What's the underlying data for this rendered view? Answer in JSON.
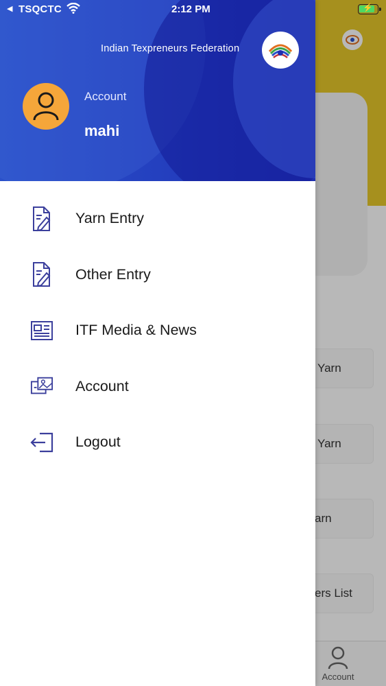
{
  "status_bar": {
    "back_glyph": "◀",
    "carrier": "TSQCTC",
    "time": "2:12 PM",
    "wifi_icon": "wifi-icon",
    "battery_icon": "battery-charging-icon"
  },
  "drawer": {
    "header": {
      "org_name": "Indian Texpreneurs Federation",
      "account_label": "Account",
      "user_name": "mahi",
      "avatar_icon": "user-icon",
      "logo_icon": "itf-logo-icon"
    },
    "menu": [
      {
        "label": "Yarn Entry",
        "icon": "document-edit-icon"
      },
      {
        "label": "Other Entry",
        "icon": "document-edit-icon"
      },
      {
        "label": "ITF Media & News",
        "icon": "newspaper-icon"
      },
      {
        "label": "Account",
        "icon": "account-card-icon"
      },
      {
        "label": "Logout",
        "icon": "logout-icon"
      }
    ]
  },
  "background_app": {
    "items": [
      "Yarn",
      "Yarn",
      "arn",
      "ers List"
    ],
    "tab_account_label": "Account"
  },
  "colors": {
    "header_blue": "#2440bf",
    "avatar_orange": "#f5a63a",
    "icon_indigo": "#3b3f9c",
    "bg_yellow": "#e6c82a"
  }
}
